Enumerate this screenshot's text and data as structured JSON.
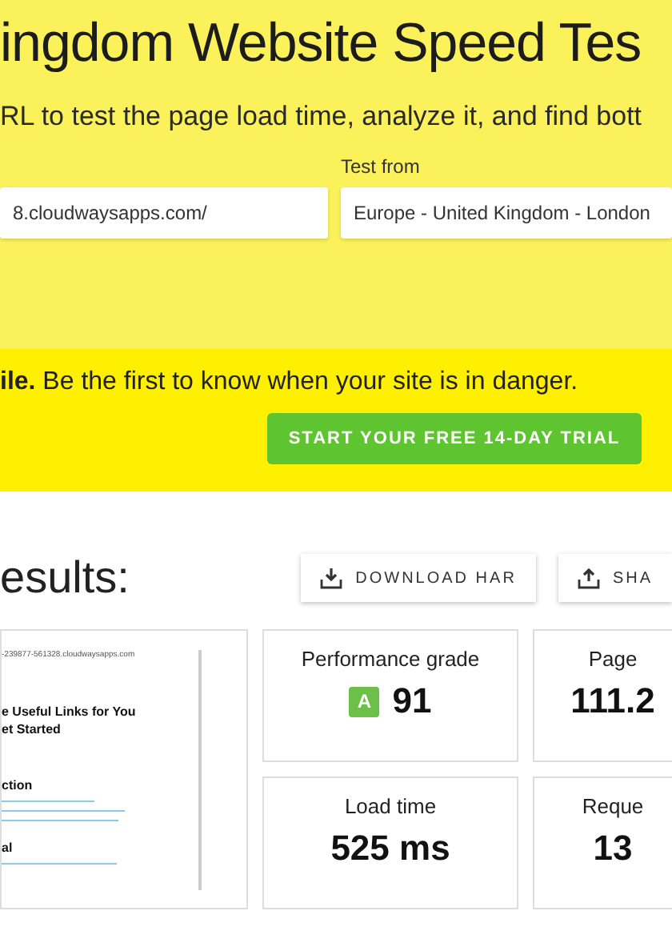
{
  "hero": {
    "title": "ingdom Website Speed Tes",
    "subtitle": "RL to test the page load time, analyze it, and find bott",
    "url_field": {
      "value": "8.cloudwaysapps.com/"
    },
    "location_field": {
      "label": "Test from",
      "value": "Europe - United Kingdom - London"
    }
  },
  "banner": {
    "text": "**ile.** Be the first to know when your site is in danger.",
    "button": "START YOUR FREE 14-DAY TRIAL"
  },
  "results": {
    "title": "esults:",
    "actions": [
      {
        "kind": "download",
        "label": "DOWNLOAD HAR"
      },
      {
        "kind": "share",
        "label": "SHA"
      }
    ],
    "preview": {
      "url": "-239877-561328.cloudwaysapps.com",
      "heading_1": "e Useful Links for You",
      "heading_2": "et Started",
      "section_1": "ction",
      "section_2": "al"
    },
    "metrics": [
      {
        "label": "Performance grade",
        "grade": "A",
        "value": "91"
      },
      {
        "label": "Page",
        "value": "111.2"
      },
      {
        "label": "Load time",
        "value": "525 ms"
      },
      {
        "label": "Reque",
        "value": "13"
      }
    ]
  }
}
